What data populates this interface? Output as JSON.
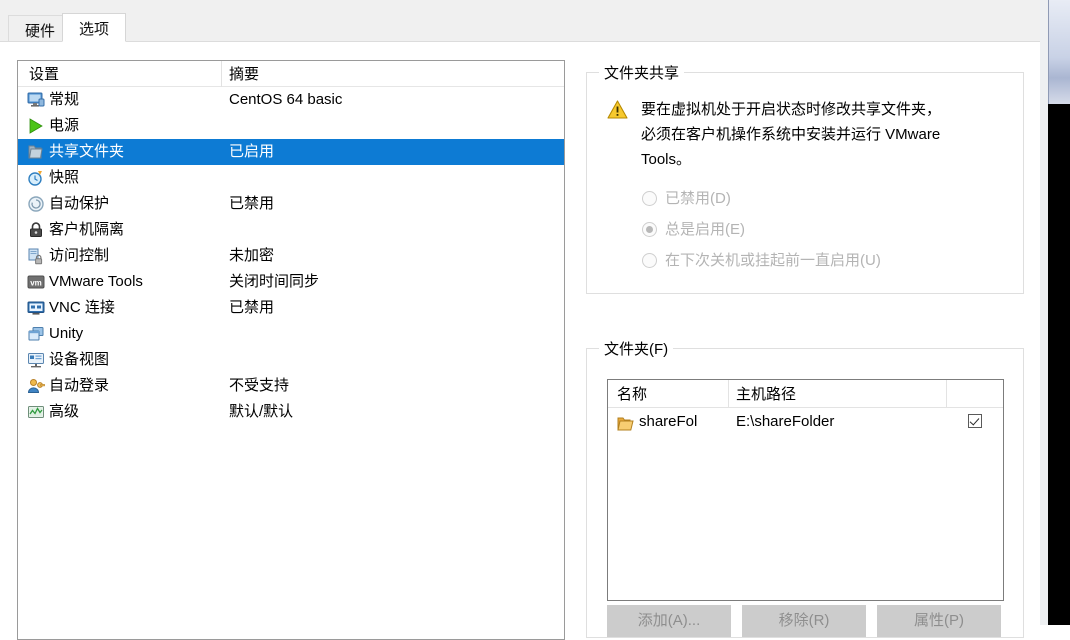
{
  "window": {
    "tabs": [
      {
        "label": "硬件",
        "active": false
      },
      {
        "label": "选项",
        "active": true
      }
    ]
  },
  "settings_list": {
    "columns": {
      "name": "设置",
      "summary": "摘要"
    },
    "items": [
      {
        "icon": "monitor-icon",
        "label": "常规",
        "summary": "CentOS 64 basic",
        "selected": false
      },
      {
        "icon": "power-play-icon",
        "label": "电源",
        "summary": "",
        "selected": false
      },
      {
        "icon": "shared-folder-icon",
        "label": "共享文件夹",
        "summary": "已启用",
        "selected": true
      },
      {
        "icon": "snapshot-clock-icon",
        "label": "快照",
        "summary": "",
        "selected": false
      },
      {
        "icon": "autoprotect-icon",
        "label": "自动保护",
        "summary": "已禁用",
        "selected": false
      },
      {
        "icon": "padlock-icon",
        "label": "客户机隔离",
        "summary": "",
        "selected": false
      },
      {
        "icon": "access-control-icon",
        "label": "访问控制",
        "summary": "未加密",
        "selected": false
      },
      {
        "icon": "vmware-tools-icon",
        "label": "VMware Tools",
        "summary": "关闭时间同步",
        "selected": false
      },
      {
        "icon": "vnc-monitor-icon",
        "label": "VNC 连接",
        "summary": "已禁用",
        "selected": false
      },
      {
        "icon": "unity-windows-icon",
        "label": "Unity",
        "summary": "",
        "selected": false
      },
      {
        "icon": "device-view-icon",
        "label": "设备视图",
        "summary": "",
        "selected": false
      },
      {
        "icon": "auto-login-icon",
        "label": "自动登录",
        "summary": "不受支持",
        "selected": false
      },
      {
        "icon": "advanced-graph-icon",
        "label": "高级",
        "summary": "默认/默认",
        "selected": false
      }
    ]
  },
  "folder_sharing": {
    "group_title": "文件夹共享",
    "warning_icon": "warning-triangle-icon",
    "warning_text": "要在虚拟机处于开启状态时修改共享文件夹，必须在客户机操作系统中安装并运行 VMware Tools。",
    "options": [
      {
        "label": "已禁用(D)",
        "checked": false
      },
      {
        "label": "总是启用(E)",
        "checked": true
      },
      {
        "label": "在下次关机或挂起前一直启用(U)",
        "checked": false
      }
    ]
  },
  "folders": {
    "group_title": "文件夹(F)",
    "columns": {
      "name": "名称",
      "host_path": "主机路径"
    },
    "rows": [
      {
        "icon": "folder-icon",
        "name": "shareFol",
        "host_path": "E:\\shareFolder",
        "enabled": true
      }
    ],
    "buttons": {
      "add": "添加(A)...",
      "remove": "移除(R)",
      "properties": "属性(P)"
    }
  },
  "colors": {
    "selection_blue": "#0d7bd4",
    "warning_yellow": "#f5c32c",
    "folder_yellow": "#f6c košik"
  }
}
